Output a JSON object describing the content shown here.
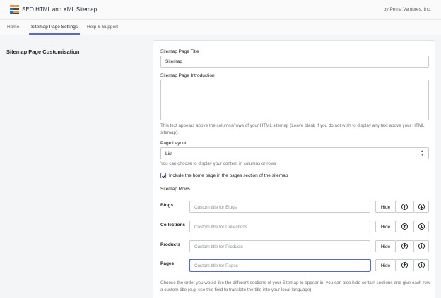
{
  "app": {
    "title": "SEO HTML and XML Sitemap",
    "byline": "by Petna Ventures, Inc."
  },
  "tabs": [
    {
      "label": "Home",
      "active": false
    },
    {
      "label": "Sitemap Page Settings",
      "active": true
    },
    {
      "label": "Help & Support",
      "active": false
    }
  ],
  "section": {
    "title": "Sitemap Page Customisation"
  },
  "form": {
    "title_label": "Sitemap Page Title",
    "title_value": "Sitemap",
    "intro_label": "Sitemap Page Introduction",
    "intro_value": "",
    "intro_help": "This text appears above the columns/rows of your HTML sitemap (Leave blank if you do not wish to display any text above your HTML sitemap).",
    "layout_label": "Page Layout",
    "layout_value": "List",
    "layout_help": "You can choose to display your content in columns or rows",
    "include_home_label": "Include the home page in the pages section of the sitemap",
    "include_home_checked": true,
    "rows_label": "Sitemap Rows",
    "rows_help": "Choose the order you would like the different sections of your Sitemap to appear in, you can also hide certain sections and give each row a custom title (e.g. use this field to translate the title into your local language)."
  },
  "rows": [
    {
      "label": "Blogs",
      "placeholder": "Custom title for Blogs",
      "hide_label": "Hide",
      "focused": false
    },
    {
      "label": "Collections",
      "placeholder": "Custom title for Collections",
      "hide_label": "Hide",
      "focused": false
    },
    {
      "label": "Products",
      "placeholder": "Custom title for Products",
      "hide_label": "Hide",
      "focused": false
    },
    {
      "label": "Pages",
      "placeholder": "Custom title for Pages",
      "hide_label": "Hide",
      "focused": true
    }
  ],
  "icons": {
    "logo": "sitemap-logo-icon",
    "select": "select-arrows-icon",
    "check": "checkmark-icon",
    "up": "arrow-up-circle-icon",
    "down": "arrow-down-circle-icon"
  },
  "colors": {
    "accent": "#5c6ac4",
    "logo_orange": "#f49342",
    "logo_blue": "#1f73b7",
    "logo_dark": "#3d4a5c"
  }
}
